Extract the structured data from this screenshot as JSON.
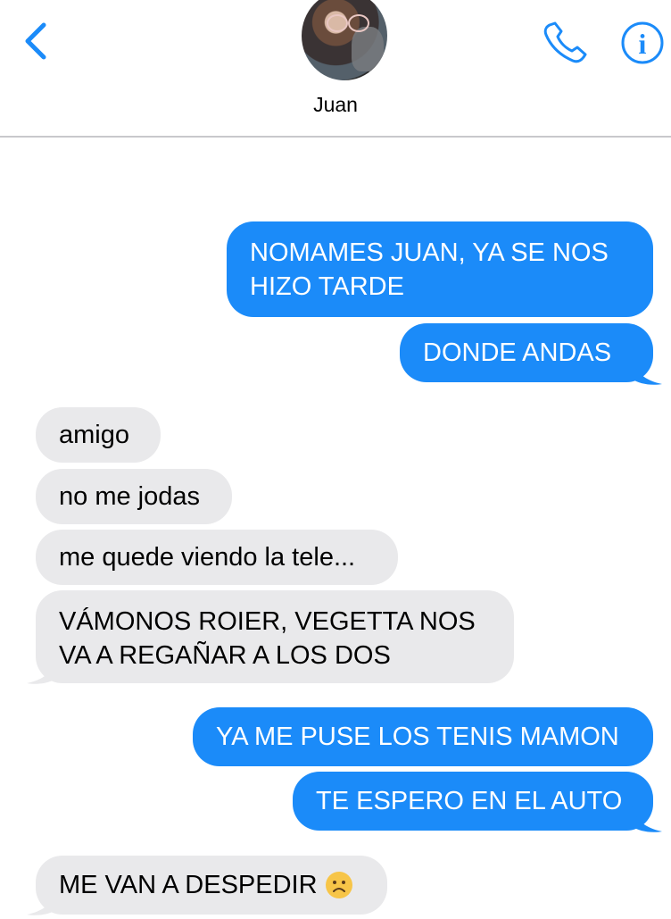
{
  "header": {
    "contact_name": "Juan",
    "back_icon": "chevron-left-icon",
    "call_icon": "phone-icon",
    "info_icon": "info-icon",
    "accent_color": "#1b8bf9"
  },
  "messages": [
    {
      "direction": "outgoing",
      "text": "NOMAMES JUAN, YA SE NOS HIZO TARDE"
    },
    {
      "direction": "outgoing",
      "text": "DONDE ANDAS"
    },
    {
      "direction": "incoming",
      "text": "amigo"
    },
    {
      "direction": "incoming",
      "text": "no me jodas"
    },
    {
      "direction": "incoming",
      "text": "me quede viendo la tele..."
    },
    {
      "direction": "incoming",
      "text": "VÁMONOS ROIER, VEGETTA NOS VA A REGAÑAR A LOS DOS"
    },
    {
      "direction": "outgoing",
      "text": "YA ME PUSE LOS TENIS MAMON"
    },
    {
      "direction": "outgoing",
      "text": "TE ESPERO EN EL AUTO"
    },
    {
      "direction": "incoming",
      "text": "ME VAN A DESPEDIR",
      "emoji": "frowning-face-icon"
    }
  ],
  "colors": {
    "outgoing_bubble": "#1b8bf9",
    "incoming_bubble": "#e9e9eb"
  }
}
